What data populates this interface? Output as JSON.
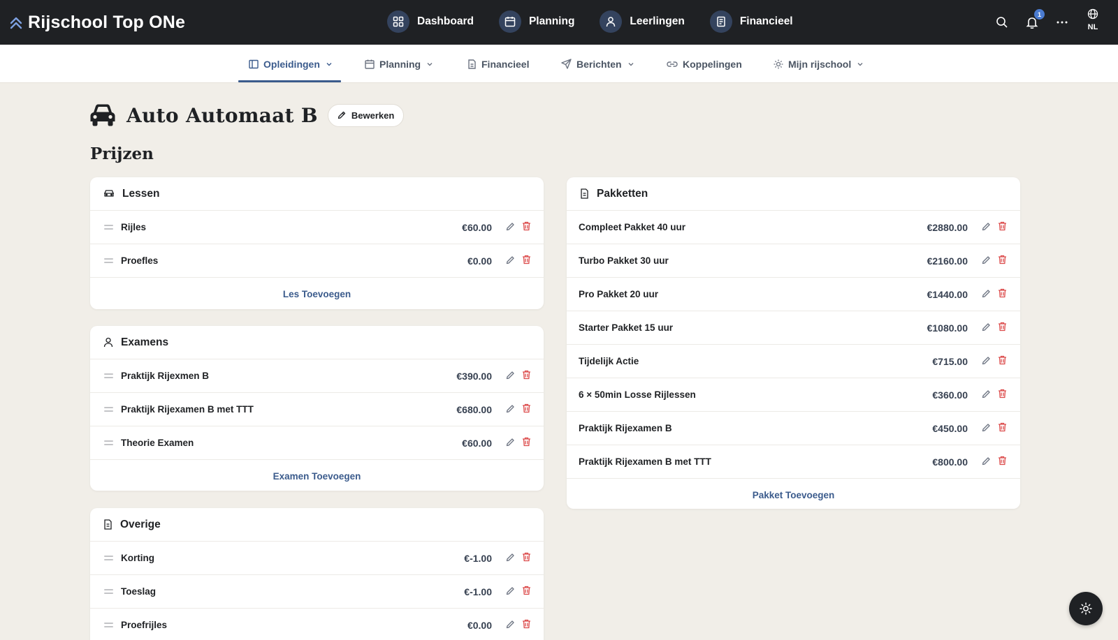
{
  "app": {
    "name": "Rijschool Top ONe",
    "colors": {
      "topbar": "#1f2124",
      "accent": "#3b5b8c",
      "danger": "#dc4a4a",
      "page_bg": "#f1eee8"
    }
  },
  "topnav": {
    "items": [
      {
        "label": "Dashboard",
        "icon": "dashboard-grid-icon"
      },
      {
        "label": "Planning",
        "icon": "calendar-icon"
      },
      {
        "label": "Leerlingen",
        "icon": "user-icon"
      },
      {
        "label": "Financieel",
        "icon": "receipt-icon"
      }
    ],
    "notification_count": "1",
    "language": "NL"
  },
  "subnav": {
    "items": [
      {
        "label": "Opleidingen",
        "icon": "columns-icon",
        "dropdown": true,
        "active": true
      },
      {
        "label": "Planning",
        "icon": "calendar-icon",
        "dropdown": true
      },
      {
        "label": "Financieel",
        "icon": "document-icon",
        "dropdown": false
      },
      {
        "label": "Berichten",
        "icon": "send-icon",
        "dropdown": true
      },
      {
        "label": "Koppelingen",
        "icon": "link-icon",
        "dropdown": false
      },
      {
        "label": "Mijn rijschool",
        "icon": "sun-settings-icon",
        "dropdown": true
      }
    ]
  },
  "page": {
    "title": "Auto Automaat B",
    "edit_label": "Bewerken",
    "section_title": "Prijzen"
  },
  "lessen": {
    "title": "Lessen",
    "rows": [
      {
        "name": "Rijles",
        "price": "€60.00"
      },
      {
        "name": "Proefles",
        "price": "€0.00"
      }
    ],
    "add_label": "Les Toevoegen"
  },
  "examens": {
    "title": "Examens",
    "rows": [
      {
        "name": "Praktijk Rijexmen B",
        "price": "€390.00"
      },
      {
        "name": "Praktijk Rijexamen B met TTT",
        "price": "€680.00"
      },
      {
        "name": "Theorie Examen",
        "price": "€60.00"
      }
    ],
    "add_label": "Examen Toevoegen"
  },
  "overige": {
    "title": "Overige",
    "rows": [
      {
        "name": "Korting",
        "price": "€-1.00"
      },
      {
        "name": "Toeslag",
        "price": "€-1.00"
      },
      {
        "name": "Proefrijles",
        "price": "€0.00"
      }
    ]
  },
  "pakketten": {
    "title": "Pakketten",
    "rows": [
      {
        "name": "Compleet Pakket 40 uur",
        "price": "€2880.00"
      },
      {
        "name": "Turbo Pakket 30 uur",
        "price": "€2160.00"
      },
      {
        "name": "Pro Pakket 20 uur",
        "price": "€1440.00"
      },
      {
        "name": "Starter Pakket 15 uur",
        "price": "€1080.00"
      },
      {
        "name": "Tijdelijk Actie",
        "price": "€715.00"
      },
      {
        "name": "6 × 50min Losse Rijlessen",
        "price": "€360.00"
      },
      {
        "name": "Praktijk Rijexamen B",
        "price": "€450.00"
      },
      {
        "name": "Praktijk Rijexamen B met TTT",
        "price": "€800.00"
      }
    ],
    "add_label": "Pakket Toevoegen"
  }
}
